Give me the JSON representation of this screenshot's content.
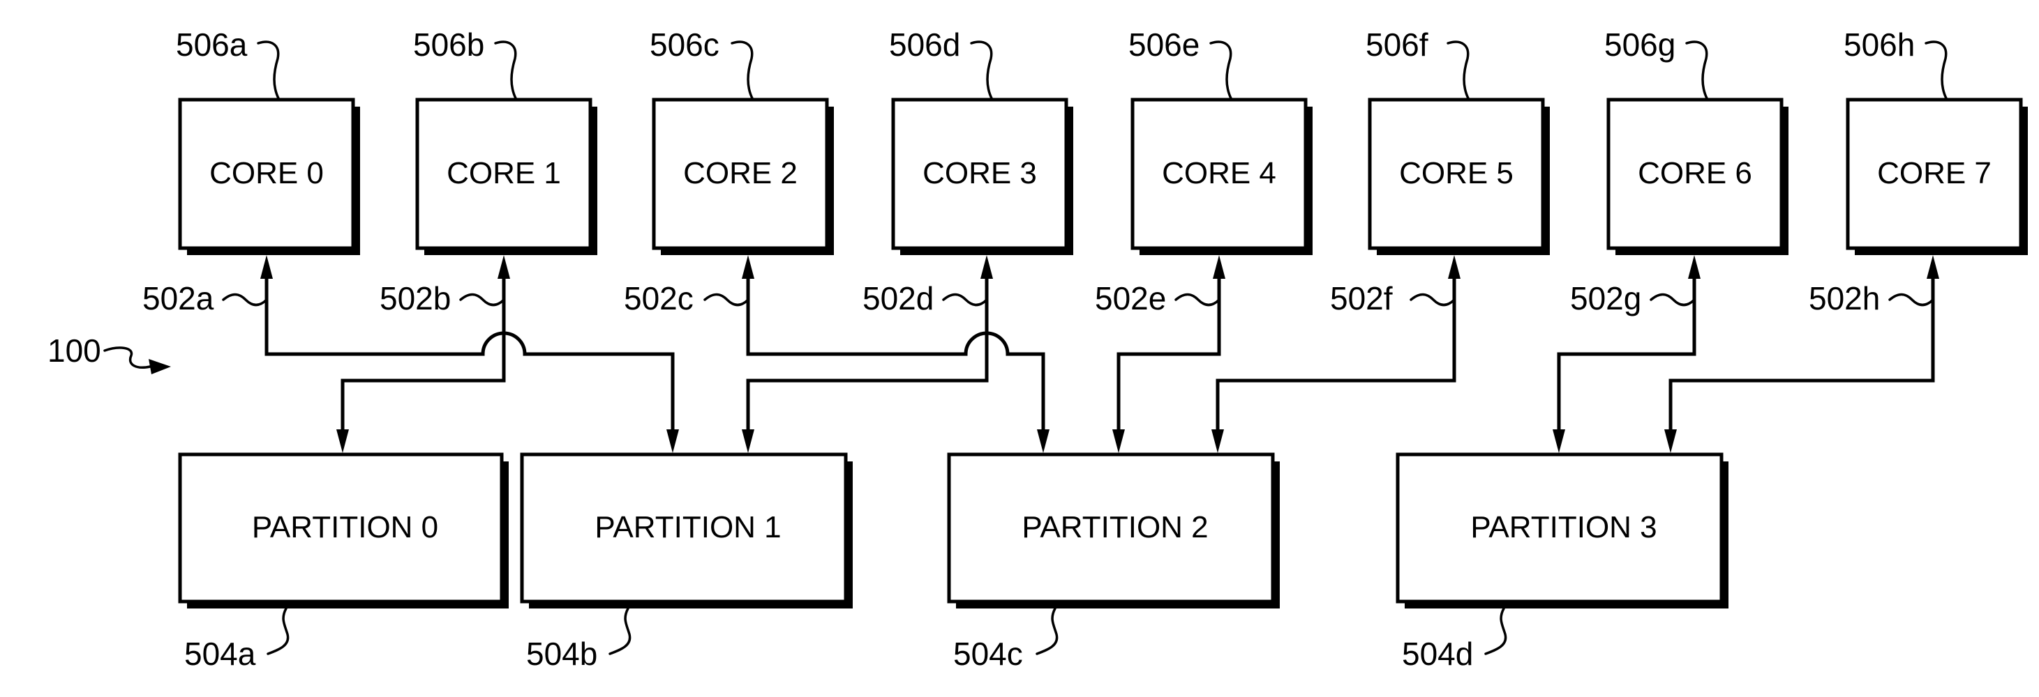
{
  "figure": {
    "reference": "100",
    "cores": [
      {
        "label": "CORE 0",
        "ref": "506a",
        "link_ref": "502a"
      },
      {
        "label": "CORE 1",
        "ref": "506b",
        "link_ref": "502b"
      },
      {
        "label": "CORE 2",
        "ref": "506c",
        "link_ref": "502c"
      },
      {
        "label": "CORE 3",
        "ref": "506d",
        "link_ref": "502d"
      },
      {
        "label": "CORE 4",
        "ref": "506e",
        "link_ref": "502e"
      },
      {
        "label": "CORE 5",
        "ref": "506f",
        "link_ref": "502f"
      },
      {
        "label": "CORE 6",
        "ref": "506g",
        "link_ref": "502g"
      },
      {
        "label": "CORE 7",
        "ref": "506h",
        "link_ref": "502h"
      }
    ],
    "partitions": [
      {
        "label": "PARTITION 0",
        "ref": "504a"
      },
      {
        "label": "PARTITION 1",
        "ref": "504b"
      },
      {
        "label": "PARTITION 2",
        "ref": "504c"
      },
      {
        "label": "PARTITION 3",
        "ref": "504d"
      }
    ],
    "connections": [
      {
        "core": 0,
        "partition": 1
      },
      {
        "core": 1,
        "partition": 0
      },
      {
        "core": 2,
        "partition": 2
      },
      {
        "core": 3,
        "partition": 1
      },
      {
        "core": 4,
        "partition": 2
      },
      {
        "core": 5,
        "partition": 2
      },
      {
        "core": 6,
        "partition": 3
      },
      {
        "core": 7,
        "partition": 3
      }
    ]
  }
}
